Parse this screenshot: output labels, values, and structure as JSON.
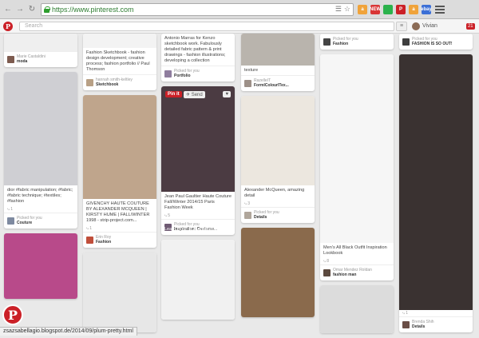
{
  "browser": {
    "url": "https://www.pinterest.com",
    "extensions": [
      {
        "name": "amazon-ext-icon",
        "label": "a",
        "color": "#f0a33a"
      },
      {
        "name": "new-ext-icon",
        "label": "NEW",
        "color": "#d93636"
      },
      {
        "name": "green-ext-icon",
        "label": "",
        "color": "#2bb24c"
      },
      {
        "name": "pinterest-ext-icon",
        "label": "P",
        "color": "#cb2027"
      },
      {
        "name": "amazon2-ext-icon",
        "label": "a",
        "color": "#f0a33a"
      },
      {
        "name": "ebay-ext-icon",
        "label": "ebay",
        "color": "#3b6fd6"
      }
    ],
    "status_url": "zsazsabellagio.blogspot.de/2014/09/plum-pretty.html"
  },
  "header": {
    "search_placeholder": "Search",
    "user_name": "Vivian",
    "notifications": "21"
  },
  "columns": [
    [
      {
        "img": "#efefef",
        "h": 22,
        "desc": "",
        "attrib_name": "Marie Castaldini",
        "attrib_board": "moda",
        "av": "#7d5b4f"
      },
      {
        "img": "#cfcfd3",
        "h": 142,
        "desc": "dior #fabric manipulation; #fabric; #fabric technique; #textiles; #fashion",
        "meta": "1",
        "attrib_name": "Picked for you",
        "attrib_board": "Couture",
        "av": "#7e8aa0"
      },
      {
        "img": "#b84a8a",
        "h": 82,
        "desc": "",
        "attrib_name": "",
        "attrib_board": "",
        "av": "#999"
      }
    ],
    [
      {
        "img": "#f3f3f3",
        "h": 18,
        "desc": "Fashion Sketchbook - fashion design development; creative process; fashion portfolio // Paul Thomson",
        "attrib_name": "hannah smith-keltley",
        "attrib_board": "Sketchbook",
        "av": "#b8a085"
      },
      {
        "img": "#bfa58c",
        "h": 130,
        "desc": "GIVENCHY HAUTE COUTURE BY ALEXANDER MCQUEEN | KIRSTY HUME | FALL/WINTER 1998 - strip-project.com...",
        "meta": "1",
        "attrib_name": "Erin Roy",
        "attrib_board": "Fashion",
        "av": "#c04e3a"
      },
      {
        "img": "#e7e7e7",
        "h": 100,
        "desc": "",
        "attrib_name": "",
        "attrib_board": "",
        "av": "#999"
      }
    ],
    [
      {
        "img": "#ffffff",
        "h": 0,
        "desc": "Antonio Marras for Kenzo sketchbook work. Fabulously detailed fabric pattern & print drawings - fashion illustrations; developing a collection",
        "attrib_name": "Picked for you",
        "attrib_board": "Portfolio",
        "av": "#8f7d9e"
      },
      {
        "img": "#4b3b42",
        "h": 132,
        "desc": "Jean Paul Gaultier Haute Couture Fall/Winter 2014/15 Paris Fashion Week",
        "meta": "5",
        "attrib_name": "Picked for you",
        "attrib_board": "Inspiration: Costume...",
        "av": "#6f5b73",
        "overlay": "Learn more at zsazsabellagi..."
      },
      {
        "img": "#f1f1f1",
        "h": 100,
        "desc": "",
        "attrib_name": "",
        "attrib_board": "",
        "av": "#999"
      }
    ],
    [
      {
        "img": "#b9b4ad",
        "h": 40,
        "desc": "texture",
        "attrib_name": "RazelleIT",
        "attrib_board": "FormlColourlTex...",
        "av": "#9d9088"
      },
      {
        "img": "#ece7df",
        "h": 112,
        "desc": "Alexander McQueen, amazing detail",
        "meta": "3",
        "attrib_name": "Picked for you",
        "attrib_board": "Details",
        "av": "#b0a69b"
      },
      {
        "img": "#8a6a4c",
        "h": 112,
        "desc": "",
        "attrib_name": "",
        "attrib_board": "",
        "av": "#999"
      }
    ],
    [
      {
        "img": "#ffffff",
        "h": 0,
        "desc": "",
        "attrib_name": "Picked for you",
        "attrib_board": "Fashion",
        "av": "#444"
      },
      {
        "img": "#f6f6f6",
        "h": 236,
        "desc": "Men's All Black Outfit Inspiration Lookbook",
        "meta": "8",
        "attrib_name": "Omar Mendez Roldan",
        "attrib_board": "fashion man",
        "av": "#5c4a3f"
      },
      {
        "img": "#dcdcdc",
        "h": 60,
        "desc": "",
        "attrib_name": "",
        "attrib_board": "",
        "av": "#999"
      }
    ],
    [
      {
        "img": "#ffffff",
        "h": 0,
        "desc": "",
        "attrib_name": "Picked for you",
        "attrib_board": "FASHION IS SO OUT!",
        "av": "#3e3e3e"
      },
      {
        "img": "#3a3231",
        "h": 320,
        "desc": "",
        "meta": "1",
        "attrib_name": "Brenda Shih",
        "attrib_board": "Details",
        "av": "#6a4e46"
      }
    ]
  ]
}
